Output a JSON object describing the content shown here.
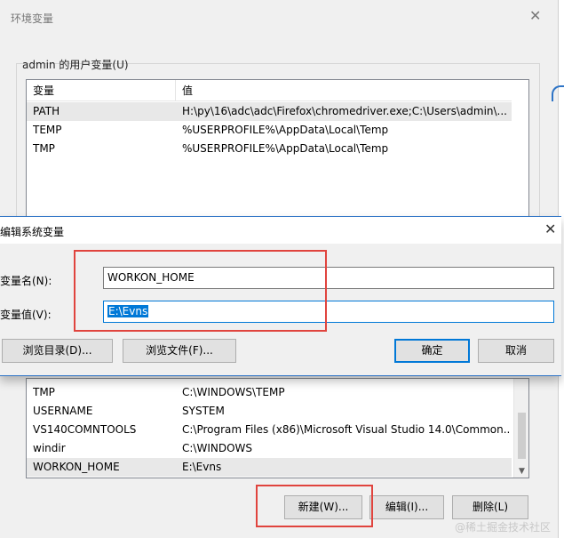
{
  "env_dialog": {
    "title": "环境变量",
    "close_glyph": "✕",
    "user_group_label": "admin 的用户变量(U)",
    "user_table": {
      "headers": [
        "变量",
        "值"
      ],
      "rows": [
        {
          "name": "PATH",
          "value": "H:\\py\\16\\adc\\adc\\Firefox\\chromedriver.exe;C:\\Users\\admin\\..."
        },
        {
          "name": "TEMP",
          "value": "%USERPROFILE%\\AppData\\Local\\Temp"
        },
        {
          "name": "TMP",
          "value": "%USERPROFILE%\\AppData\\Local\\Temp"
        }
      ]
    },
    "system_table": {
      "rows": [
        {
          "name": "TMP",
          "value": "C:\\WINDOWS\\TEMP"
        },
        {
          "name": "USERNAME",
          "value": "SYSTEM"
        },
        {
          "name": "VS140COMNTOOLS",
          "value": "C:\\Program Files (x86)\\Microsoft Visual Studio 14.0\\Common..."
        },
        {
          "name": "windir",
          "value": "C:\\WINDOWS"
        },
        {
          "name": "WORKON_HOME",
          "value": "E:\\Evns"
        }
      ]
    },
    "buttons": {
      "new": "新建(W)...",
      "edit": "编辑(I)...",
      "delete": "删除(L)"
    }
  },
  "edit_dialog": {
    "title": "编辑系统变量",
    "close_glyph": "✕",
    "name_label": "变量名(N):",
    "name_value": "WORKON_HOME",
    "value_label": "变量值(V):",
    "value_value": "E:\\Evns",
    "buttons": {
      "browse_dir": "浏览目录(D)...",
      "browse_file": "浏览文件(F)...",
      "ok": "确定",
      "cancel": "取消"
    }
  },
  "watermark": "@稀土掘金技术社区",
  "colors": {
    "accent_blue": "#0078d7",
    "highlight_red": "#e0443e",
    "dialog_bg": "#f0f0f0"
  }
}
